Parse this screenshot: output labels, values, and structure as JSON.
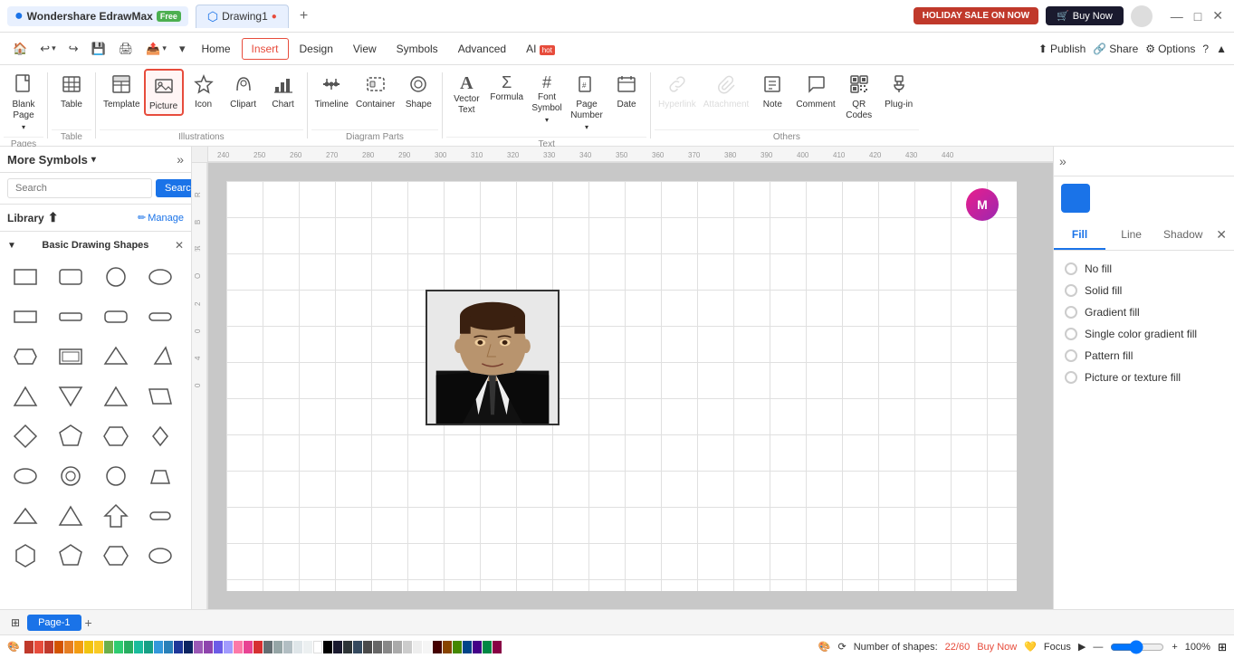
{
  "app": {
    "name": "Wondershare EdrawMax",
    "free_badge": "Free",
    "tab_name": "Drawing1"
  },
  "title_bar": {
    "holiday_btn": "HOLIDAY SALE ON NOW",
    "buy_btn": "Buy Now",
    "minimize": "—",
    "maximize": "□",
    "close": "✕"
  },
  "menu": {
    "items": [
      "Home",
      "Insert",
      "Design",
      "View",
      "Symbols",
      "Advanced",
      "AI"
    ],
    "ai_badge": "hot",
    "active": "Insert",
    "publish": "Publish",
    "share": "Share",
    "options": "Options"
  },
  "ribbon": {
    "groups": {
      "pages": {
        "label": "Pages",
        "items": [
          {
            "id": "blank-page",
            "icon": "📄",
            "label": "Blank\nPage",
            "has_arrow": true
          }
        ]
      },
      "table": {
        "label": "Table",
        "items": [
          {
            "id": "table",
            "icon": "⊞",
            "label": "Table"
          }
        ]
      },
      "illustrations": {
        "label": "Illustrations",
        "items": [
          {
            "id": "template",
            "icon": "🖼",
            "label": "Template"
          },
          {
            "id": "picture",
            "icon": "🖼",
            "label": "Picture",
            "active": true
          },
          {
            "id": "icon",
            "icon": "☆",
            "label": "Icon"
          },
          {
            "id": "clipart",
            "icon": "✂",
            "label": "Clipart"
          },
          {
            "id": "chart",
            "icon": "📊",
            "label": "Chart"
          }
        ]
      },
      "diagram_parts": {
        "label": "Diagram Parts",
        "items": [
          {
            "id": "timeline",
            "icon": "⏶",
            "label": "Timeline"
          },
          {
            "id": "container",
            "icon": "⬜",
            "label": "Container"
          },
          {
            "id": "shape",
            "icon": "◎",
            "label": "Shape"
          }
        ]
      },
      "text": {
        "label": "Text",
        "items": [
          {
            "id": "vector-text",
            "icon": "A",
            "label": "Vector\nText"
          },
          {
            "id": "formula",
            "icon": "Σ",
            "label": "Formula"
          },
          {
            "id": "font-symbol",
            "icon": "#",
            "label": "Font\nSymbol",
            "has_arrow": true
          },
          {
            "id": "page-number",
            "icon": "🔖",
            "label": "Page\nNumber",
            "has_arrow": true
          },
          {
            "id": "date",
            "icon": "📅",
            "label": "Date"
          }
        ]
      },
      "others": {
        "label": "Others",
        "items": [
          {
            "id": "hyperlink",
            "icon": "🔗",
            "label": "Hyperlink",
            "disabled": true
          },
          {
            "id": "attachment",
            "icon": "📎",
            "label": "Attachment",
            "disabled": true
          },
          {
            "id": "note",
            "icon": "📝",
            "label": "Note"
          },
          {
            "id": "comment",
            "icon": "💬",
            "label": "Comment"
          },
          {
            "id": "qr-codes",
            "icon": "⊞",
            "label": "QR\nCodes"
          },
          {
            "id": "plug-in",
            "icon": "🔌",
            "label": "Plug-in"
          }
        ]
      }
    }
  },
  "sidebar": {
    "title": "More Symbols",
    "search_placeholder": "Search",
    "search_btn": "Search",
    "library_title": "Library",
    "manage_btn": "Manage",
    "section_title": "Basic Drawing Shapes"
  },
  "canvas": {
    "zoom": "100%",
    "shapes_count": "22/60",
    "buy_now": "Buy Now",
    "focus": "Focus",
    "page_tab": "Page-1"
  },
  "right_panel": {
    "tabs": [
      "Fill",
      "Line",
      "Shadow"
    ],
    "active_tab": "Fill",
    "fill_options": [
      "No fill",
      "Solid fill",
      "Gradient fill",
      "Single color gradient fill",
      "Pattern fill",
      "Picture or texture fill"
    ]
  },
  "colors": [
    "#c0392b",
    "#e74c3c",
    "#e67e22",
    "#f39c12",
    "#f1c40f",
    "#2ecc71",
    "#27ae60",
    "#1abc9c",
    "#16a085",
    "#3498db",
    "#2980b9",
    "#9b59b6",
    "#8e44ad",
    "#34495e",
    "#2c3e50",
    "#95a5a6",
    "#7f8c8d",
    "#bdc3c7",
    "#ecf0f1",
    "#ffffff",
    "#000000",
    "#333333"
  ]
}
